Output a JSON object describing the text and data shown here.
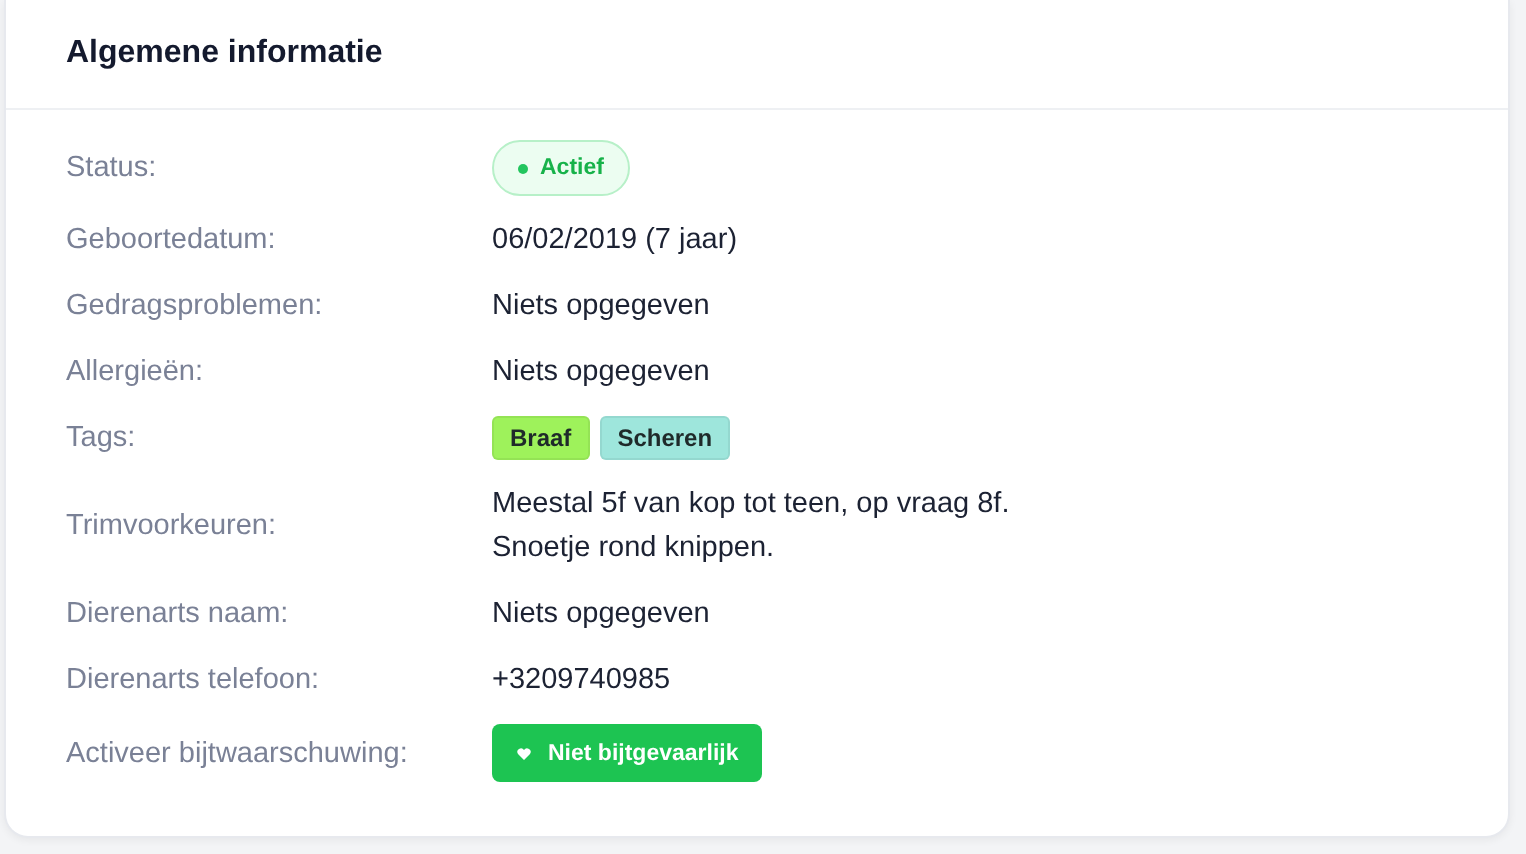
{
  "card": {
    "title": "Algemene informatie"
  },
  "rows": [
    {
      "label": "Status:",
      "kind": "badge",
      "value": "Actief"
    },
    {
      "label": "Geboortedatum:",
      "kind": "text",
      "value": "06/02/2019 (7 jaar)"
    },
    {
      "label": "Gedragsproblemen:",
      "kind": "text",
      "value": "Niets opgegeven"
    },
    {
      "label": "Allergieën:",
      "kind": "text",
      "value": "Niets opgegeven"
    },
    {
      "label": "Tags:",
      "kind": "tags",
      "tags": [
        {
          "text": "Braaf",
          "color": "#9ef25b"
        },
        {
          "text": "Scheren",
          "color": "#9ee6dc"
        }
      ]
    },
    {
      "label": "Trimvoorkeuren:",
      "kind": "lines",
      "lines": [
        "Meestal 5f van kop tot teen, op vraag 8f.",
        "Snoetje rond knippen."
      ]
    },
    {
      "label": "Dierenarts naam:",
      "kind": "text",
      "value": "Niets opgegeven"
    },
    {
      "label": "Dierenarts telefoon:",
      "kind": "text",
      "value": "+3209740985"
    },
    {
      "label": "Activeer bijtwaarschuwing:",
      "kind": "button",
      "value": "Niet bijtgevaarlijk"
    }
  ]
}
